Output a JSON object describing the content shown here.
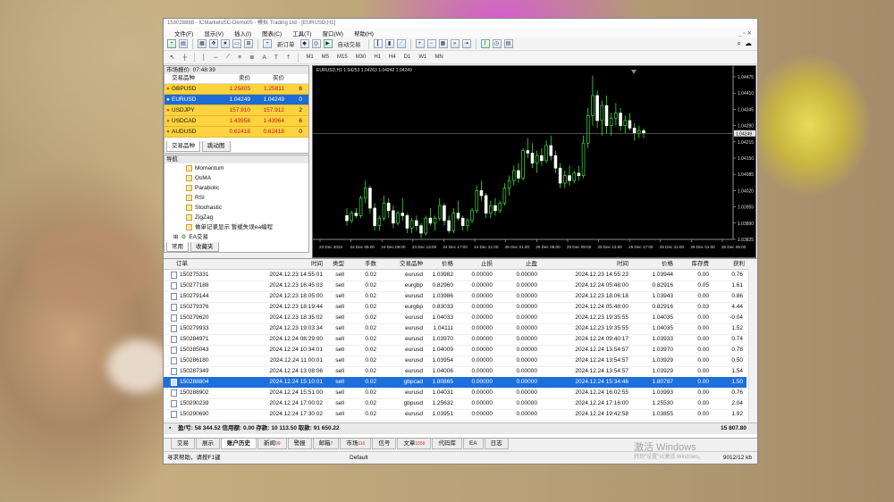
{
  "window": {
    "title": "153028888 - ICMarketsSC-Demo05 - 模拟 Trading Ltd - [EURUSD,H1]",
    "menu": [
      "文件(F)",
      "显示(V)",
      "插入(I)",
      "图表(C)",
      "工具(T)",
      "窗口(W)",
      "帮助(H)"
    ],
    "toolbar": {
      "new_order": "新订单",
      "autotrade": "自动交易",
      "periods": [
        "M1",
        "M5",
        "M15",
        "M30",
        "H1",
        "H4",
        "D1",
        "W1",
        "MN"
      ]
    }
  },
  "market_watch": {
    "title": "市场报价: 07:48:39",
    "columns": [
      "交易品种",
      "卖价",
      "买价",
      ""
    ],
    "rows": [
      {
        "symbol": "GBPUSD",
        "bid": "1.25805",
        "ask": "1.25811",
        "spread": "6"
      },
      {
        "symbol": "EURUSD",
        "bid": "1.04249",
        "ask": "1.04249",
        "spread": "0"
      },
      {
        "symbol": "USDJPY",
        "bid": "157.910",
        "ask": "157.912",
        "spread": "2"
      },
      {
        "symbol": "USDCAD",
        "bid": "1.43958",
        "ask": "1.43964",
        "spread": "6"
      },
      {
        "symbol": "AUDUSD",
        "bid": "0.62418",
        "ask": "0.62418",
        "spread": "0"
      }
    ],
    "tabs": [
      "交易品种",
      "跳动图"
    ]
  },
  "navigator": {
    "title": "导航",
    "items": [
      "Momentum",
      "OsMA",
      "Parabolic",
      "RSI",
      "Stochastic",
      "ZigZag",
      "做单记录显示 暂缓失误ea编程"
    ],
    "expert_label": "EA交易",
    "tabs": [
      "常用",
      "收藏夹"
    ]
  },
  "chart": {
    "info": "EURUSD,H1  1.04253 1.04263 1.04242 1.04249",
    "current_price_label": "1.04249"
  },
  "chart_data": {
    "type": "candlestick",
    "title": "EURUSD,H1",
    "x_tick_labels": [
      "23 Dec 2024",
      "24 Dec 05:00",
      "24 Dec 09:00",
      "24 Dec 13:00",
      "24 Dec 17:00",
      "24 Dec 21:00",
      "25 Dec 01:00",
      "25 Dec 05:00",
      "25 Dec 09:00",
      "25 Dec 13:00",
      "25 Dec 17:00",
      "25 Dec 21:00",
      "26 Dec 01:00",
      "26 Dec 05:00"
    ],
    "y_tick_labels": [
      "1.04475",
      "1.04410",
      "1.04345",
      "1.04280",
      "1.04215",
      "1.04150",
      "1.04085",
      "1.04020",
      "1.03955",
      "1.03890",
      "1.03825"
    ],
    "ylim": [
      1.03825,
      1.04475
    ],
    "current_price": 1.04249,
    "candles": [
      [
        1.0392,
        1.0395,
        1.0388,
        1.039
      ],
      [
        1.039,
        1.0394,
        1.0389,
        1.0393
      ],
      [
        1.0393,
        1.0395,
        1.0391,
        1.0392
      ],
      [
        1.0392,
        1.04,
        1.0391,
        1.0399
      ],
      [
        1.0399,
        1.0406,
        1.0397,
        1.0403
      ],
      [
        1.0403,
        1.0404,
        1.0393,
        1.0395
      ],
      [
        1.0395,
        1.0397,
        1.0386,
        1.0388
      ],
      [
        1.0388,
        1.0392,
        1.0386,
        1.0391
      ],
      [
        1.0391,
        1.04,
        1.039,
        1.0397
      ],
      [
        1.0397,
        1.0399,
        1.0391,
        1.0394
      ],
      [
        1.0394,
        1.0396,
        1.0387,
        1.0389
      ],
      [
        1.0389,
        1.0394,
        1.0388,
        1.0393
      ],
      [
        1.0393,
        1.0399,
        1.039,
        1.0392
      ],
      [
        1.0392,
        1.0393,
        1.0385,
        1.0387
      ],
      [
        1.0387,
        1.0391,
        1.0385,
        1.039
      ],
      [
        1.039,
        1.0392,
        1.0386,
        1.0388
      ],
      [
        1.0388,
        1.0389,
        1.0383,
        1.0385
      ],
      [
        1.0385,
        1.0392,
        1.0384,
        1.0391
      ],
      [
        1.0391,
        1.0395,
        1.0388,
        1.0389
      ],
      [
        1.0389,
        1.0392,
        1.0386,
        1.0391
      ],
      [
        1.0391,
        1.0399,
        1.039,
        1.0396
      ],
      [
        1.0396,
        1.0397,
        1.0388,
        1.039
      ],
      [
        1.039,
        1.0392,
        1.0385,
        1.0386
      ],
      [
        1.0386,
        1.0395,
        1.0385,
        1.0393
      ],
      [
        1.0393,
        1.0398,
        1.039,
        1.0391
      ],
      [
        1.0391,
        1.0392,
        1.0386,
        1.0388
      ],
      [
        1.0388,
        1.0391,
        1.0386,
        1.039
      ],
      [
        1.039,
        1.0395,
        1.0389,
        1.0394
      ],
      [
        1.0394,
        1.0404,
        1.0393,
        1.0402
      ],
      [
        1.0402,
        1.0406,
        1.0398,
        1.04
      ],
      [
        1.04,
        1.0401,
        1.0391,
        1.0393
      ],
      [
        1.0393,
        1.0398,
        1.0391,
        1.0396
      ],
      [
        1.0396,
        1.0399,
        1.0392,
        1.0394
      ],
      [
        1.0394,
        1.0398,
        1.0393,
        1.0397
      ],
      [
        1.0397,
        1.0405,
        1.0396,
        1.0403
      ],
      [
        1.0403,
        1.0408,
        1.04,
        1.0406
      ],
      [
        1.0406,
        1.0412,
        1.0404,
        1.041
      ],
      [
        1.041,
        1.0413,
        1.0405,
        1.0407
      ],
      [
        1.0407,
        1.0419,
        1.0406,
        1.0418
      ],
      [
        1.0418,
        1.0423,
        1.0415,
        1.0417
      ],
      [
        1.0417,
        1.0421,
        1.0411,
        1.0413
      ],
      [
        1.0413,
        1.0418,
        1.0409,
        1.0416
      ],
      [
        1.0416,
        1.0419,
        1.0412,
        1.0414
      ],
      [
        1.0414,
        1.0422,
        1.0413,
        1.042
      ],
      [
        1.042,
        1.0424,
        1.0414,
        1.0416
      ],
      [
        1.0416,
        1.0418,
        1.0409,
        1.0411
      ],
      [
        1.0411,
        1.0413,
        1.0403,
        1.0405
      ],
      [
        1.0405,
        1.041,
        1.0403,
        1.0408
      ],
      [
        1.0408,
        1.0412,
        1.0404,
        1.0406
      ],
      [
        1.0406,
        1.041,
        1.0405,
        1.0409
      ],
      [
        1.0409,
        1.0412,
        1.0406,
        1.0408
      ],
      [
        1.0408,
        1.0424,
        1.0407,
        1.0421
      ],
      [
        1.0421,
        1.0435,
        1.0419,
        1.0432
      ],
      [
        1.0432,
        1.0448,
        1.0428,
        1.044
      ],
      [
        1.044,
        1.0442,
        1.0427,
        1.043
      ],
      [
        1.043,
        1.0438,
        1.0424,
        1.0436
      ],
      [
        1.0436,
        1.044,
        1.0425,
        1.0428
      ],
      [
        1.0428,
        1.0433,
        1.0424,
        1.0431
      ],
      [
        1.0431,
        1.0437,
        1.0428,
        1.0433
      ],
      [
        1.0433,
        1.0435,
        1.0426,
        1.0428
      ],
      [
        1.0428,
        1.0432,
        1.0425,
        1.043
      ],
      [
        1.043,
        1.0433,
        1.0426,
        1.0427
      ],
      [
        1.0427,
        1.0429,
        1.0422,
        1.0425
      ],
      [
        1.0425,
        1.0428,
        1.0423,
        1.0426
      ],
      [
        1.0426,
        1.0427,
        1.0423,
        1.0425
      ]
    ]
  },
  "terminal": {
    "columns": [
      "订单",
      "时间",
      "类型",
      "手数",
      "交易品种",
      "价格",
      "止损",
      "止盈",
      "时间",
      "价格",
      "库存费",
      "获利"
    ],
    "rows": [
      [
        "150275331",
        "2024.12.23 14:55:01",
        "sell",
        "0.02",
        "eurusd",
        "1.03982",
        "0.00000",
        "0.00000",
        "2024.12.23 14:55:23",
        "1.03944",
        "0.00",
        "0.76"
      ],
      [
        "150277188",
        "2024.12.23 16:45:03",
        "sell",
        "0.02",
        "eurgbp",
        "0.82960",
        "0.00000",
        "0.00000",
        "2024.12.24 05:48:00",
        "0.82916",
        "0.05",
        "1.61"
      ],
      [
        "150279144",
        "2024.12.23 18:05:00",
        "sell",
        "0.02",
        "eurusd",
        "1.03986",
        "0.00000",
        "0.00000",
        "2024.12.23 18:06:18",
        "1.03943",
        "0.00",
        "0.86"
      ],
      [
        "150279376",
        "2024.12.23 18:19:44",
        "sell",
        "0.02",
        "eurgbp",
        "0.83033",
        "0.00000",
        "0.00000",
        "2024.12.24 05:48:00",
        "0.82916",
        "0.03",
        "4.44"
      ],
      [
        "150279620",
        "2024.12.23 18:35:02",
        "sell",
        "0.02",
        "eurusd",
        "1.04033",
        "0.00000",
        "0.00000",
        "2024.12.23 19:35:55",
        "1.04035",
        "0.00",
        "-0.04"
      ],
      [
        "150279933",
        "2024.12.23 19:03:34",
        "sell",
        "0.02",
        "eurusd",
        "1.04111",
        "0.00000",
        "0.00000",
        "2024.12.23 19:35:55",
        "1.04035",
        "0.00",
        "1.52"
      ],
      [
        "150284971",
        "2024.12.24 08:29:00",
        "sell",
        "0.02",
        "eurusd",
        "1.03970",
        "0.00000",
        "0.00000",
        "2024.12.24 09:40:17",
        "1.03933",
        "0.00",
        "0.74"
      ],
      [
        "150285043",
        "2024.12.24 10:34:01",
        "sell",
        "0.02",
        "eurusd",
        "1.04009",
        "0.00000",
        "0.00000",
        "2024.12.24 13:54:57",
        "1.03970",
        "0.00",
        "0.78"
      ],
      [
        "150286180",
        "2024.12.24 11:00:01",
        "sell",
        "0.02",
        "eurusd",
        "1.03954",
        "0.00000",
        "0.00000",
        "2024.12.24 13:54:57",
        "1.03929",
        "0.00",
        "0.50"
      ],
      [
        "150287349",
        "2024.12.24 13:08:06",
        "sell",
        "0.02",
        "eurusd",
        "1.04006",
        "0.00000",
        "0.00000",
        "2024.12.24 13:54:57",
        "1.03929",
        "0.00",
        "1.54"
      ],
      [
        "150288804",
        "2024.12.24 15:10:01",
        "sell",
        "0.02",
        "gbpcad",
        "1.80865",
        "0.00000",
        "0.00000",
        "2024.12.24 15:34:46",
        "1.80787",
        "0.00",
        "1.50"
      ],
      [
        "150288902",
        "2024.12.24 15:51:00",
        "sell",
        "0.02",
        "eurusd",
        "1.04031",
        "0.00000",
        "0.00000",
        "2024.12.24 16:02:55",
        "1.03993",
        "0.00",
        "0.76"
      ],
      [
        "150290239",
        "2024.12.24 17:00:02",
        "sell",
        "0.02",
        "gbpusd",
        "1.25632",
        "0.00000",
        "0.00000",
        "2024.12.24 17:16:00",
        "1.25530",
        "0.00",
        "2.04"
      ],
      [
        "150290690",
        "2024.12.24 17:30:02",
        "sell",
        "0.02",
        "eurusd",
        "1.03951",
        "0.00000",
        "0.00000",
        "2024.12.24 19:42:58",
        "1.03855",
        "0.00",
        "1.92"
      ]
    ],
    "selected_row": 10,
    "totals_label": "盈/亏: 58 344.52  信用额: 0.00  存款: 10 113.50  取款: 91 650.22",
    "totals_value": "15 807.80",
    "tabs": [
      {
        "label": "交易",
        "badge": ""
      },
      {
        "label": "展示",
        "badge": ""
      },
      {
        "label": "账户历史",
        "badge": ""
      },
      {
        "label": "新闻",
        "badge": "99"
      },
      {
        "label": "警报",
        "badge": ""
      },
      {
        "label": "邮箱",
        "badge": "7"
      },
      {
        "label": "市场",
        "badge": "116"
      },
      {
        "label": "信号",
        "badge": ""
      },
      {
        "label": "文章",
        "badge": "1559"
      },
      {
        "label": "代码库",
        "badge": ""
      },
      {
        "label": "EA",
        "badge": ""
      },
      {
        "label": "日志",
        "badge": ""
      }
    ],
    "active_tab": 2
  },
  "status": {
    "help": "寻求帮助，请按F1键",
    "profile": "Default",
    "traffic": "9012/12 kb"
  },
  "watermark": {
    "line1": "激活 Windows",
    "line2": "转到\"设置\"以激活 Windows。"
  }
}
